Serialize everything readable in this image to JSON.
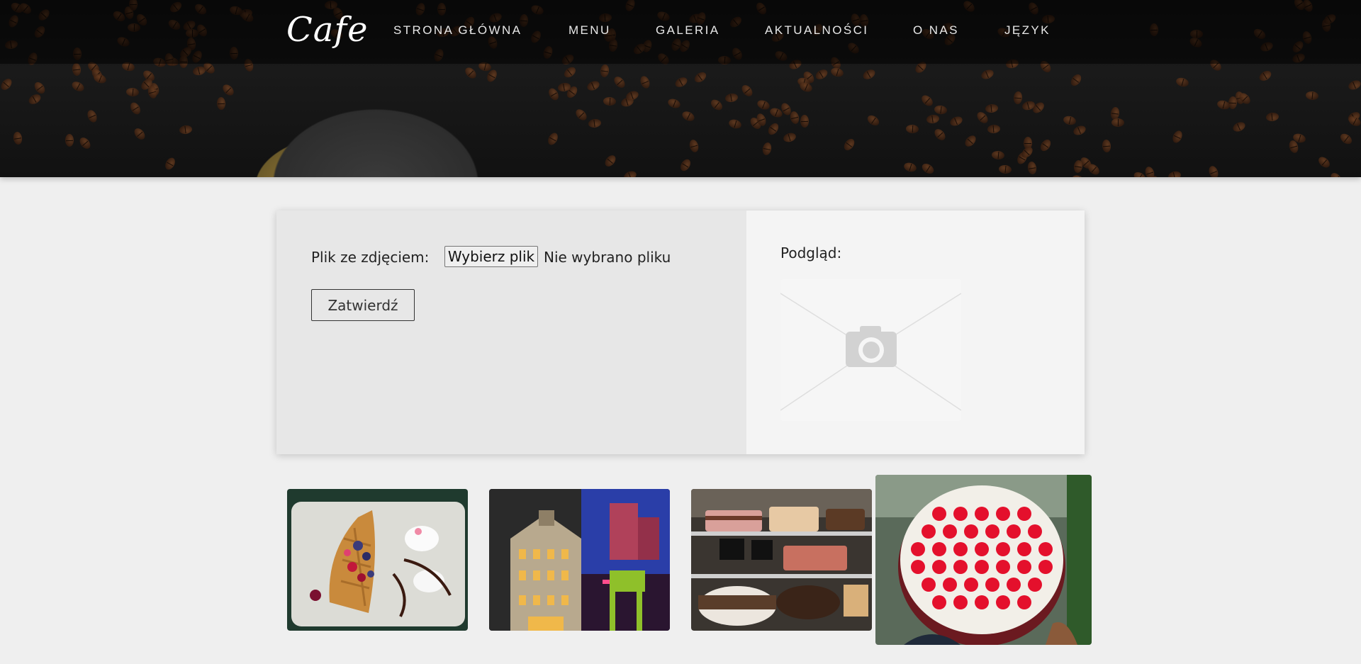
{
  "header": {
    "logo": "Cafe",
    "nav": [
      {
        "label": "STRONA GŁÓWNA"
      },
      {
        "label": "MENU"
      },
      {
        "label": "GALERIA"
      },
      {
        "label": "AKTUALNOŚCI"
      },
      {
        "label": "O NAS"
      },
      {
        "label": "JĘZYK"
      }
    ]
  },
  "upload": {
    "file_label": "Plik ze zdjęciem:",
    "choose_button": "Wybierz plik",
    "file_status": "Nie wybrano pliku",
    "submit_button": "Zatwierdź",
    "preview_label": "Podgląd:"
  },
  "icons": {
    "preview_placeholder": "camera-icon"
  },
  "gallery": {
    "items": [
      {
        "subject": "waffle-with-berries"
      },
      {
        "subject": "ceramic-house-lantern"
      },
      {
        "subject": "cake-display-case"
      },
      {
        "subject": "raspberry-cake"
      }
    ]
  },
  "colors": {
    "header_bg": "#111111",
    "page_bg": "#efefef",
    "panel_left_bg": "#e7e7e7",
    "panel_right_bg": "#f4f4f4",
    "nav_text": "#e8e8e8"
  }
}
